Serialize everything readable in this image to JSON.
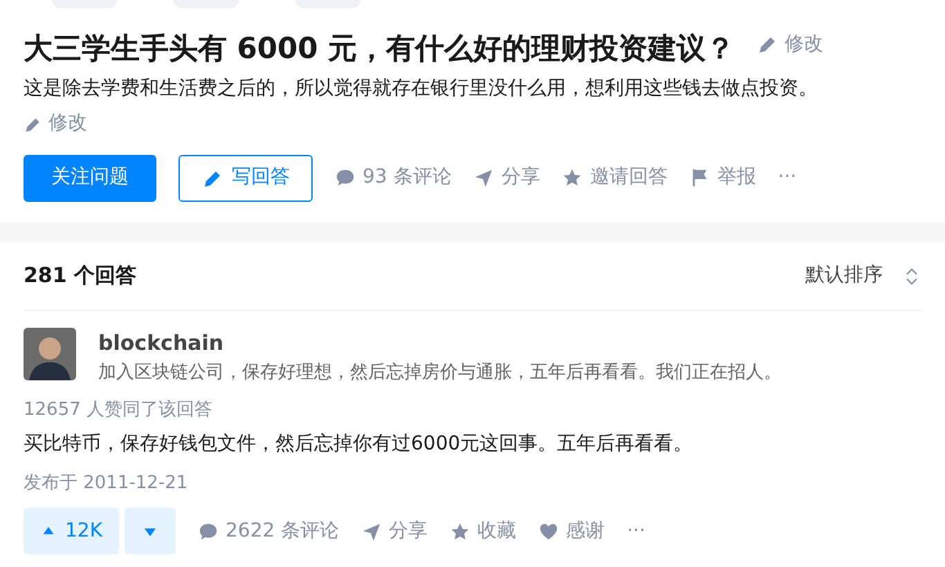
{
  "question": {
    "title": "大三学生手头有 6000 元，有什么好的理财投资建议？",
    "title_edit": "修改",
    "description": "这是除去学费和生活费之后的，所以觉得就存在银行里没什么用，想利用这些钱去做点投资。",
    "description_edit": "修改",
    "buttons": [
      {
        "kind": "primary",
        "label": "关注问题"
      },
      {
        "kind": "write",
        "label": "写回答"
      }
    ],
    "actions": [
      {
        "kind": "comment",
        "label": "93 条评论"
      },
      {
        "kind": "share",
        "label": "分享"
      },
      {
        "kind": "star",
        "label": "邀请回答"
      },
      {
        "kind": "flag",
        "label": "举报"
      },
      {
        "kind": "more",
        "label": "···"
      }
    ]
  },
  "answers": {
    "count": "281 个回答",
    "sort": "默认排序",
    "items": [
      {
        "author": "blockchain",
        "headline": "加入区块链公司，保存好理想，然后忘掉房价与通胀，五年后再看看。我们正在招人。",
        "votes_note": "12657 人赞同了该回答",
        "content": "买比特币，保存好钱包文件，然后忘掉你有过6000元这回事。五年后再看看。",
        "date": "发布于 2011-12-21",
        "upvote": "12K",
        "actions": [
          {
            "kind": "comment",
            "label": "2622 条评论"
          },
          {
            "kind": "share",
            "label": "分享"
          },
          {
            "kind": "star",
            "label": "收藏"
          },
          {
            "kind": "heart",
            "label": "感谢"
          },
          {
            "kind": "more",
            "label": "···"
          }
        ]
      }
    ]
  }
}
